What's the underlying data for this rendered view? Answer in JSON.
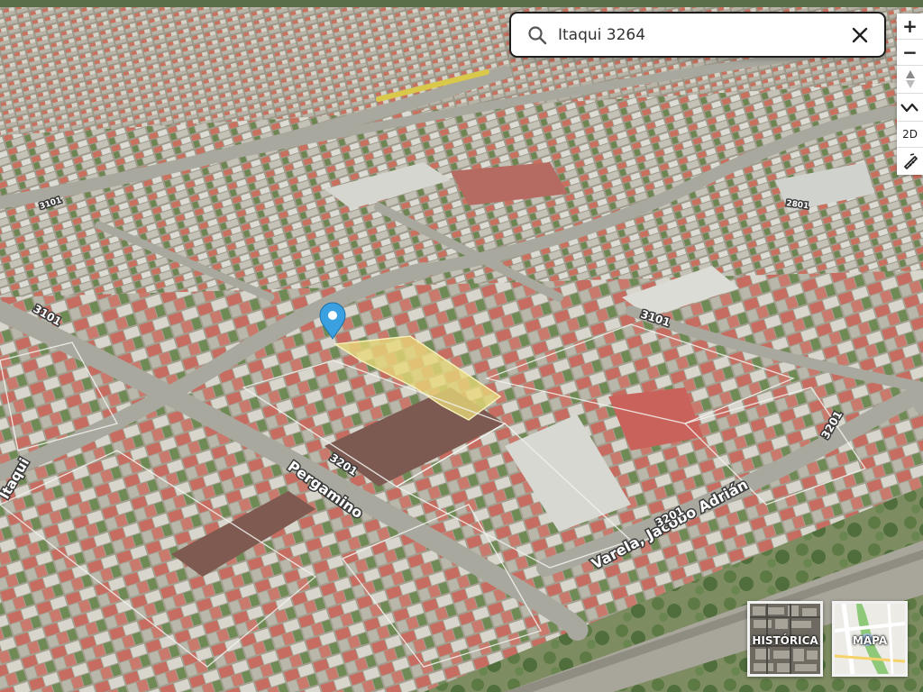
{
  "search": {
    "value": "Itaqui 3264",
    "placeholder": "Itaqui 3264"
  },
  "controls": {
    "zoom_in": "+",
    "zoom_out": "−",
    "view_2d": "2D"
  },
  "streets": {
    "pergamino": "Pergamino",
    "pergamino_number": "3201",
    "varela": "Varela, Jacobo Adrián",
    "varela_number": "3201",
    "itaqui": "Itaqui",
    "number_3101_left": "3101",
    "number_3101_right": "3101",
    "number_3201_right": "3201",
    "number_3101_top": "3101",
    "number_2801": "2801"
  },
  "layers": {
    "historic_label": "HISTÓRICA",
    "map_label": "MAPA"
  },
  "colors": {
    "highlight_parcel": "#e8d878",
    "marker": "#3aa0e0",
    "roof_red": "#c76a5e",
    "roof_gray": "#b8b8b2",
    "vegetation": "#5b7a45"
  },
  "icons": {
    "search": "search-icon",
    "clear": "close-icon",
    "zoom_in": "plus-icon",
    "zoom_out": "minus-icon",
    "compass": "compass-icon",
    "tilt": "tilt-icon",
    "view_2d": "2d-icon",
    "measure": "ruler-icon",
    "marker": "map-pin-icon"
  }
}
